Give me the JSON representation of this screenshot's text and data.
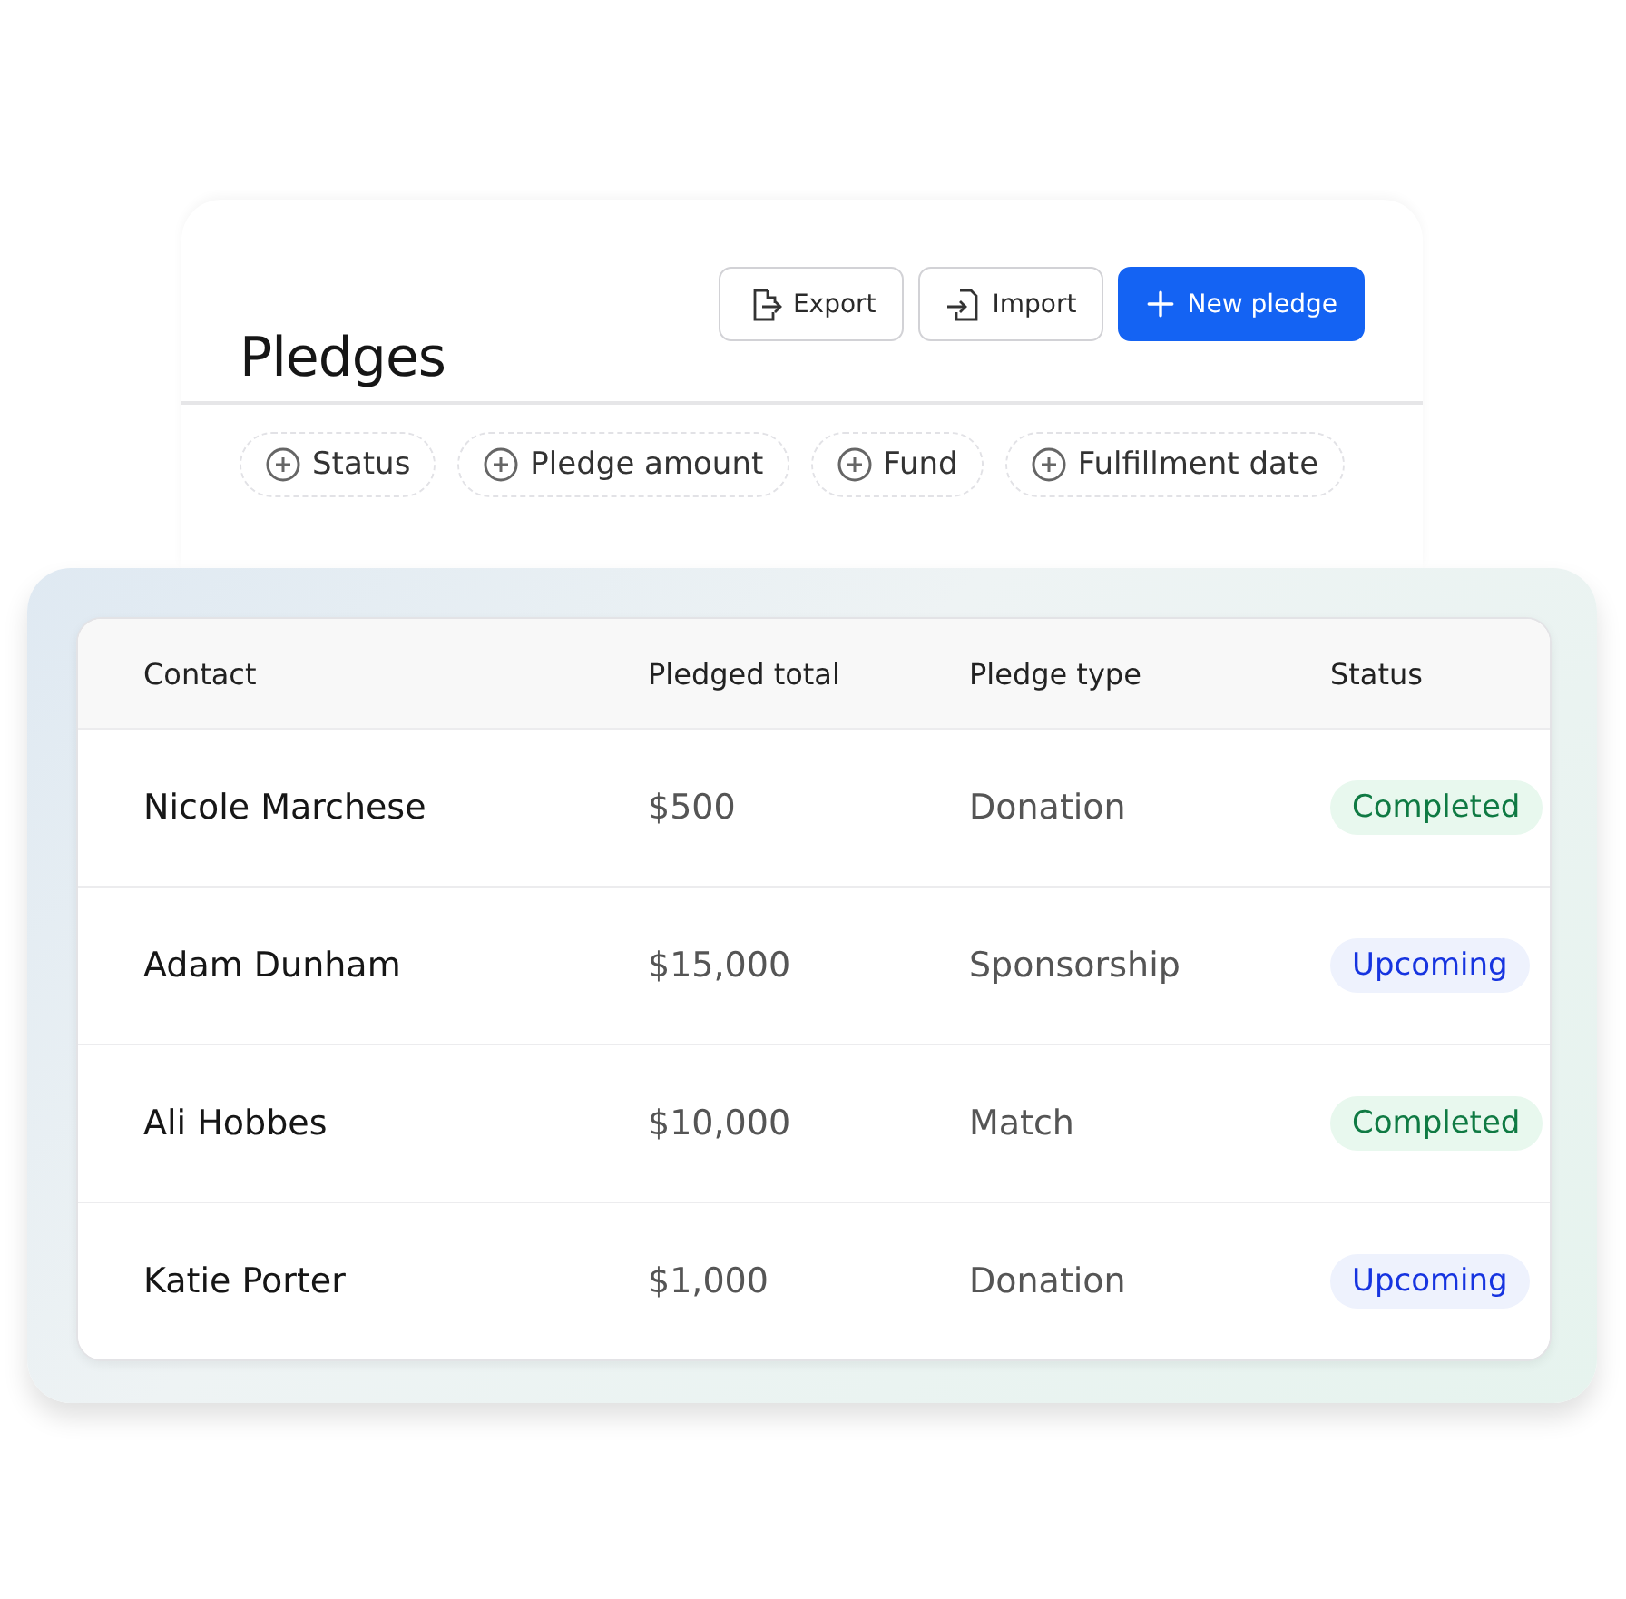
{
  "header": {
    "title": "Pledges",
    "buttons": [
      {
        "kind": "export",
        "label": "Export"
      },
      {
        "kind": "import",
        "label": "Import"
      },
      {
        "kind": "primary",
        "label": "New pledge"
      }
    ]
  },
  "filters": [
    "Status",
    "Pledge amount",
    "Fund",
    "Fulfillment date"
  ],
  "table": {
    "columns": [
      "Contact",
      "Pledged total",
      "Pledge type",
      "Status"
    ],
    "rows": [
      {
        "contact": "Nicole Marchese",
        "total": "$500",
        "type": "Donation",
        "status": {
          "label": "Completed",
          "kind": "completed"
        }
      },
      {
        "contact": "Adam Dunham",
        "total": "$15,000",
        "type": "Sponsorship",
        "status": {
          "label": "Upcoming",
          "kind": "upcoming"
        }
      },
      {
        "contact": "Ali Hobbes",
        "total": "$10,000",
        "type": "Match",
        "status": {
          "label": "Completed",
          "kind": "completed"
        }
      },
      {
        "contact": "Katie Porter",
        "total": "$1,000",
        "type": "Donation",
        "status": {
          "label": "Upcoming",
          "kind": "upcoming"
        }
      }
    ]
  }
}
